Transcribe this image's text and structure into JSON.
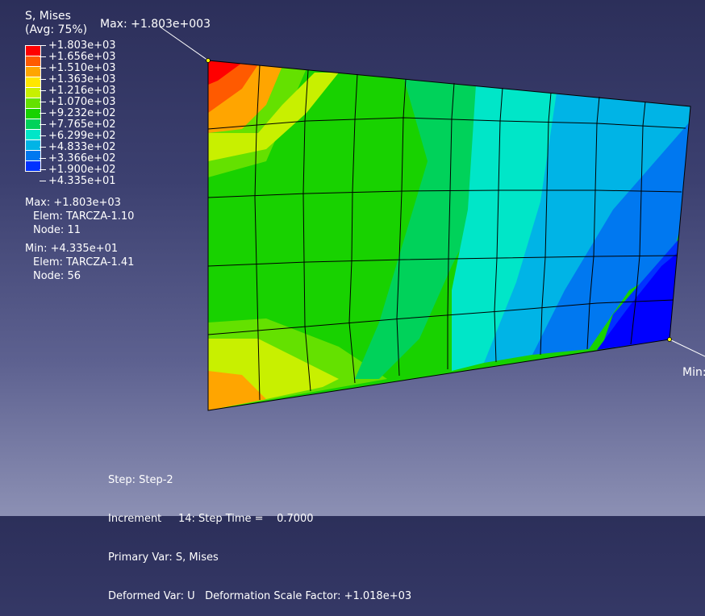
{
  "legend": {
    "title": "S, Mises",
    "subtitle": "(Avg: 75%)",
    "levels": [
      {
        "label": "+1.803e+03",
        "color": "#ff0000"
      },
      {
        "label": "+1.656e+03",
        "color": "#ff5a00"
      },
      {
        "label": "+1.510e+03",
        "color": "#ffa500"
      },
      {
        "label": "+1.363e+03",
        "color": "#ffe600"
      },
      {
        "label": "+1.216e+03",
        "color": "#c8f000"
      },
      {
        "label": "+1.070e+03",
        "color": "#64e100"
      },
      {
        "label": "+9.232e+02",
        "color": "#18d200"
      },
      {
        "label": "+7.765e+02",
        "color": "#00d25a"
      },
      {
        "label": "+6.299e+02",
        "color": "#00e6c8"
      },
      {
        "label": "+4.833e+02",
        "color": "#00b4e6"
      },
      {
        "label": "+3.366e+02",
        "color": "#0078f0"
      },
      {
        "label": "+1.900e+02",
        "color": "#0032ff"
      },
      {
        "label": "+4.335e+01",
        "color": "#0000ff"
      }
    ]
  },
  "max_info": {
    "value": "Max: +1.803e+03",
    "elem": "Elem: TARCZA-1.10",
    "node": "Node: 11"
  },
  "min_info": {
    "value": "Min: +4.335e+01",
    "elem": "Elem: TARCZA-1.41",
    "node": "Node: 56"
  },
  "annotations": {
    "max_label": "Max: +1.803e+003",
    "min_label": "Min:"
  },
  "footer": {
    "step": "Step: Step-2",
    "increment": "Increment     14: Step Time =    0.7000",
    "primary": "Primary Var: S, Mises",
    "deformed": "Deformed Var: U   Deformation Scale Factor: +1.018e+03"
  }
}
